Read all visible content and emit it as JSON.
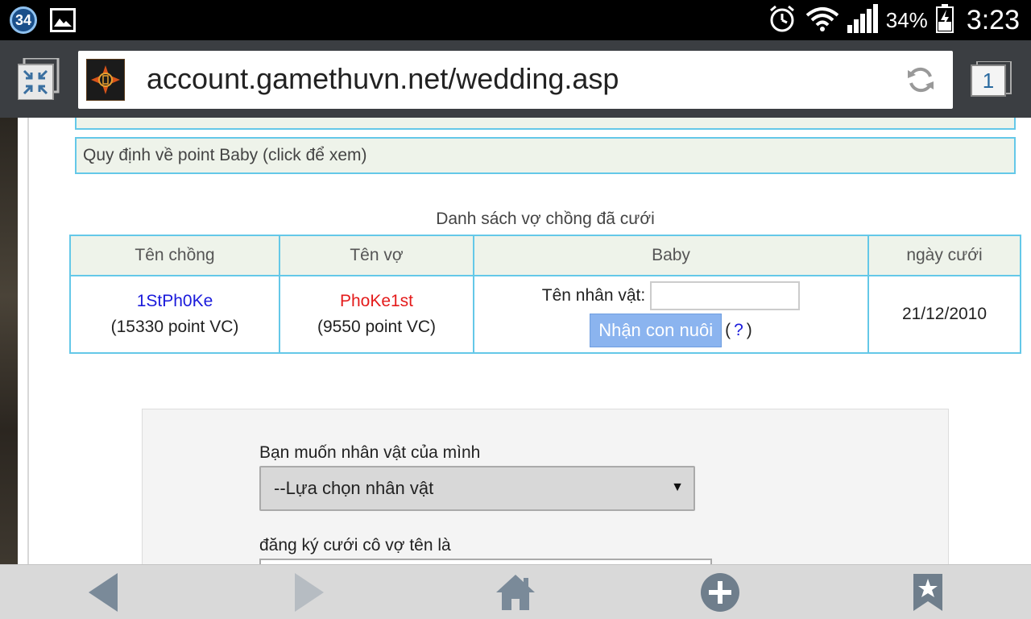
{
  "status_bar": {
    "notification_count": "34",
    "battery_percent": "34%",
    "time": "3:23"
  },
  "browser": {
    "url": "account.gamethuvn.net/wedding.asp",
    "tab_count": "1"
  },
  "page": {
    "info_top": "",
    "info_baby_points": "Quy định về point Baby (click để xem)",
    "married_list_caption": "Danh sách vợ chồng đã cưới",
    "table": {
      "headers": [
        "Tên chồng",
        "Tên vợ",
        "Baby",
        "ngày cưới"
      ],
      "rows": [
        {
          "husband_name": "1StPh0Ke",
          "husband_points": "(15330 point VC)",
          "wife_name": "PhoKe1st",
          "wife_points": "(9550 point VC)",
          "baby_label": "Tên nhân vật:",
          "baby_input_value": "",
          "adopt_button": "Nhận con nuôi",
          "help_open": "(",
          "help_link": "?",
          "help_close": ")",
          "wedding_date": "21/12/2010"
        }
      ]
    },
    "register": {
      "character_label": "Bạn muốn nhân vật của mình",
      "character_select": "--Lựa chọn nhân vật",
      "wife_label": "đăng ký cưới  cô vợ tên là",
      "wife_input_value": ""
    }
  },
  "colors": {
    "accent_border": "#64c8e8",
    "husband_color": "#1a1adb",
    "wife_color": "#e41b1b",
    "button_bg": "#8bb4ef"
  }
}
